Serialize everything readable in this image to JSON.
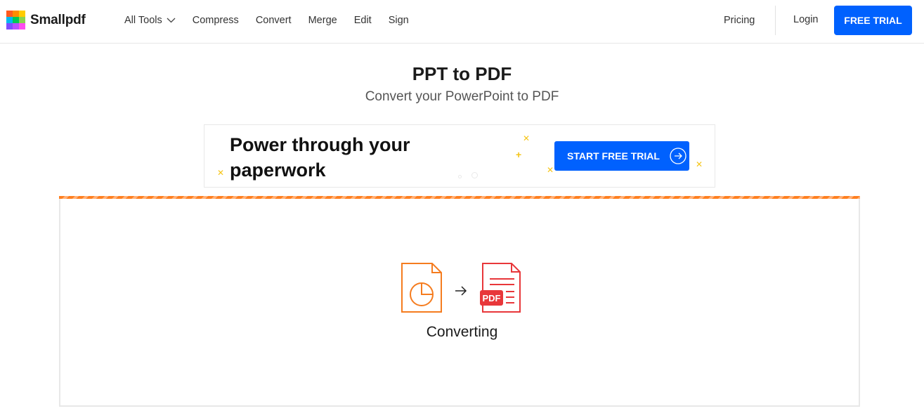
{
  "header": {
    "brand": "Smallpdf",
    "logo_colors": [
      "#ff5a1f",
      "#ff8c00",
      "#ffcc00",
      "#00b8f0",
      "#00c853",
      "#8bd44f",
      "#7c4dff",
      "#b84dff",
      "#ff4df0"
    ],
    "nav": [
      {
        "label": "All Tools",
        "icon": "chevron-down-icon"
      },
      {
        "label": "Compress"
      },
      {
        "label": "Convert"
      },
      {
        "label": "Merge"
      },
      {
        "label": "Edit"
      },
      {
        "label": "Sign"
      }
    ],
    "pricing": "Pricing",
    "login": "Login",
    "free_trial": "FREE TRIAL"
  },
  "page": {
    "title": "PPT to PDF",
    "subtitle": "Convert your PowerPoint to PDF"
  },
  "banner": {
    "headline_line1": "Power through your",
    "headline_line2": "paperwork",
    "cta": "START FREE TRIAL",
    "cta_icon": "arrow-right-circle-icon"
  },
  "converter": {
    "status": "Converting",
    "source_icon": "ppt-file-icon",
    "target_icon": "pdf-file-icon",
    "target_badge": "PDF",
    "source_color": "#f57c1f",
    "target_color": "#e8373a",
    "progress_stripe_color": "#ff7f1f"
  },
  "colors": {
    "accent": "#0061fe"
  }
}
